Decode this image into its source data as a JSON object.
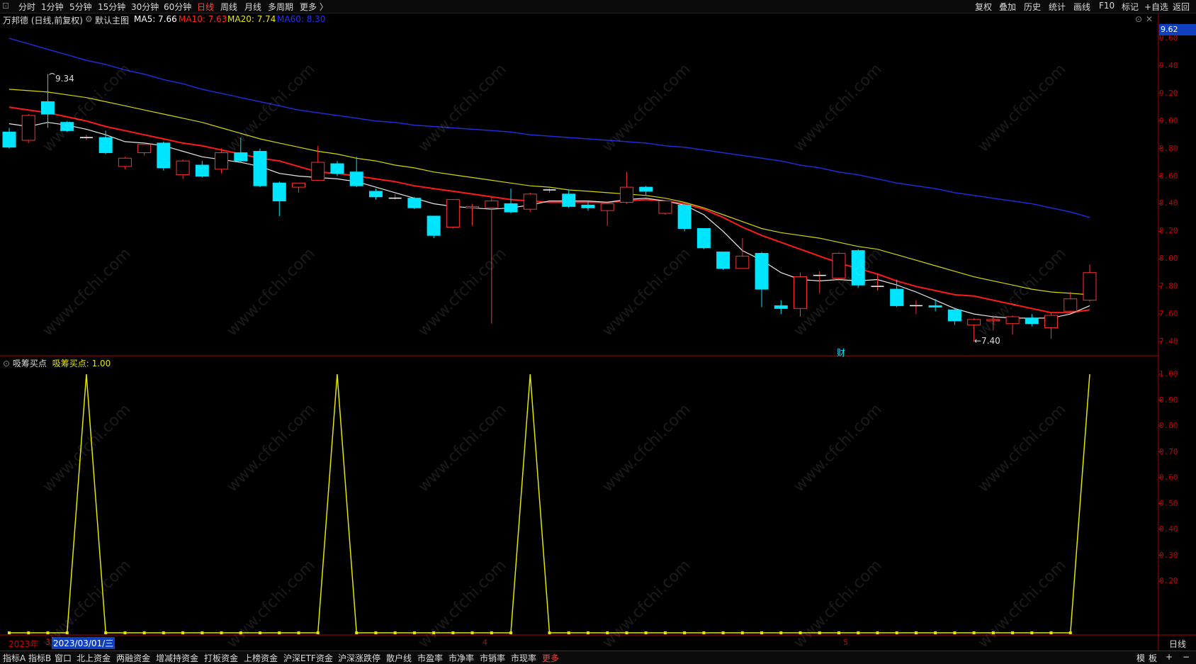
{
  "topbar": {
    "left": [
      "分时",
      "1分钟",
      "5分钟",
      "15分钟",
      "30分钟",
      "60分钟",
      "日线",
      "周线",
      "月线",
      "多周期",
      "更多 〉"
    ],
    "active": "日线",
    "right": [
      "复权",
      "叠加",
      "历史",
      "统计",
      "画线",
      "F10",
      "标记",
      "+自选",
      "返回"
    ]
  },
  "info": {
    "stock": "万邦德 (日线,前复权)",
    "main": "默认主图",
    "ma5": "MA5: 7.66",
    "ma10": "MA10: 7.63",
    "ma20": "MA20: 7.74",
    "ma60": "MA60: 8.30"
  },
  "colors": {
    "ma5": "#ffffff",
    "ma10": "#ff2020",
    "ma20": "#e6e600",
    "ma60": "#2020ff",
    "up": "#ff3030",
    "down": "#00e5ff",
    "axis": "#c80000"
  },
  "price_axis": {
    "current": "9.62",
    "labels": [
      "9.60",
      "9.40",
      "9.20",
      "9.00",
      "8.80",
      "8.60",
      "8.40",
      "8.20",
      "8.00",
      "7.80",
      "7.60",
      "7.40"
    ]
  },
  "annotations": {
    "high": "9.34",
    "low": "←7.40",
    "cai": "财"
  },
  "indicator": {
    "title": "吸筹买点",
    "value": "吸筹买点: 1.00",
    "labels": [
      "1.00",
      "0.90",
      "0.80",
      "0.70",
      "0.60",
      "0.50",
      "0.40",
      "0.30",
      "0.20"
    ]
  },
  "time_axis": {
    "year": "2023年",
    "m3": "3",
    "cursor_date": "2023/03/01/三",
    "m4": "4",
    "m5": "5",
    "right": "日线"
  },
  "bottombar": {
    "left": [
      "指标A",
      "指标B",
      "窗口",
      "北上资金",
      "两融资金",
      "增减持资金",
      "打板资金",
      "上榜资金",
      "沪深ETF资金",
      "沪深涨跌停",
      "散户线",
      "市盈率",
      "市净率",
      "市销率",
      "市现率",
      "更多"
    ],
    "right": [
      "模",
      "板",
      "+",
      "−"
    ]
  },
  "watermark": "www.cfchi.com",
  "chart_data": [
    {
      "type": "candlestick",
      "title": "万邦德 (日线,前复权)",
      "ylim": [
        7.3,
        9.7
      ],
      "candles": [
        {
          "o": 8.92,
          "h": 8.95,
          "l": 8.8,
          "c": 8.81
        },
        {
          "o": 8.86,
          "h": 9.05,
          "l": 8.84,
          "c": 9.04
        },
        {
          "o": 9.14,
          "h": 9.34,
          "l": 8.95,
          "c": 9.05
        },
        {
          "o": 8.99,
          "h": 9.0,
          "l": 8.92,
          "c": 8.93
        },
        {
          "o": 8.88,
          "h": 8.9,
          "l": 8.86,
          "c": 8.88
        },
        {
          "o": 8.88,
          "h": 8.93,
          "l": 8.76,
          "c": 8.77
        },
        {
          "o": 8.67,
          "h": 8.74,
          "l": 8.65,
          "c": 8.73
        },
        {
          "o": 8.77,
          "h": 8.84,
          "l": 8.75,
          "c": 8.83
        },
        {
          "o": 8.84,
          "h": 8.85,
          "l": 8.64,
          "c": 8.66
        },
        {
          "o": 8.61,
          "h": 8.72,
          "l": 8.58,
          "c": 8.71
        },
        {
          "o": 8.68,
          "h": 8.71,
          "l": 8.59,
          "c": 8.6
        },
        {
          "o": 8.65,
          "h": 8.8,
          "l": 8.62,
          "c": 8.77
        },
        {
          "o": 8.77,
          "h": 8.88,
          "l": 8.7,
          "c": 8.71
        },
        {
          "o": 8.78,
          "h": 8.8,
          "l": 8.52,
          "c": 8.53
        },
        {
          "o": 8.55,
          "h": 8.56,
          "l": 8.31,
          "c": 8.42
        },
        {
          "o": 8.52,
          "h": 8.55,
          "l": 8.48,
          "c": 8.55
        },
        {
          "o": 8.57,
          "h": 8.82,
          "l": 8.57,
          "c": 8.7
        },
        {
          "o": 8.69,
          "h": 8.71,
          "l": 8.6,
          "c": 8.62
        },
        {
          "o": 8.63,
          "h": 8.74,
          "l": 8.52,
          "c": 8.53
        },
        {
          "o": 8.49,
          "h": 8.51,
          "l": 8.43,
          "c": 8.45
        },
        {
          "o": 8.44,
          "h": 8.47,
          "l": 8.43,
          "c": 8.44
        },
        {
          "o": 8.44,
          "h": 8.45,
          "l": 8.36,
          "c": 8.37
        },
        {
          "o": 8.31,
          "h": 8.31,
          "l": 8.15,
          "c": 8.17
        },
        {
          "o": 8.23,
          "h": 8.43,
          "l": 8.22,
          "c": 8.43
        },
        {
          "o": 8.37,
          "h": 8.4,
          "l": 8.24,
          "c": 8.38
        },
        {
          "o": 8.37,
          "h": 8.45,
          "l": 7.53,
          "c": 8.42
        },
        {
          "o": 8.4,
          "h": 8.51,
          "l": 8.33,
          "c": 8.34
        },
        {
          "o": 8.36,
          "h": 8.48,
          "l": 8.34,
          "c": 8.47
        },
        {
          "o": 8.5,
          "h": 8.51,
          "l": 8.48,
          "c": 8.5
        },
        {
          "o": 8.47,
          "h": 8.5,
          "l": 8.37,
          "c": 8.38
        },
        {
          "o": 8.39,
          "h": 8.42,
          "l": 8.35,
          "c": 8.37
        },
        {
          "o": 8.35,
          "h": 8.4,
          "l": 8.24,
          "c": 8.4
        },
        {
          "o": 8.41,
          "h": 8.63,
          "l": 8.4,
          "c": 8.52
        },
        {
          "o": 8.52,
          "h": 8.53,
          "l": 8.46,
          "c": 8.49
        },
        {
          "o": 8.33,
          "h": 8.41,
          "l": 8.32,
          "c": 8.42
        },
        {
          "o": 8.39,
          "h": 8.4,
          "l": 8.2,
          "c": 8.22
        },
        {
          "o": 8.22,
          "h": 8.22,
          "l": 8.07,
          "c": 8.08
        },
        {
          "o": 8.05,
          "h": 8.05,
          "l": 7.92,
          "c": 7.93
        },
        {
          "o": 7.93,
          "h": 8.15,
          "l": 7.93,
          "c": 8.02
        },
        {
          "o": 8.04,
          "h": 8.05,
          "l": 7.65,
          "c": 7.78
        },
        {
          "o": 7.66,
          "h": 7.7,
          "l": 7.6,
          "c": 7.64
        },
        {
          "o": 7.64,
          "h": 7.9,
          "l": 7.58,
          "c": 7.87
        },
        {
          "o": 7.88,
          "h": 7.91,
          "l": 7.75,
          "c": 7.88
        },
        {
          "o": 7.86,
          "h": 8.05,
          "l": 7.85,
          "c": 8.04
        },
        {
          "o": 8.06,
          "h": 8.07,
          "l": 7.79,
          "c": 7.81
        },
        {
          "o": 7.8,
          "h": 7.89,
          "l": 7.77,
          "c": 7.8
        },
        {
          "o": 7.78,
          "h": 7.85,
          "l": 7.65,
          "c": 7.66
        },
        {
          "o": 7.66,
          "h": 7.7,
          "l": 7.6,
          "c": 7.66
        },
        {
          "o": 7.66,
          "h": 7.71,
          "l": 7.62,
          "c": 7.65
        },
        {
          "o": 7.63,
          "h": 7.64,
          "l": 7.52,
          "c": 7.55
        },
        {
          "o": 7.52,
          "h": 7.57,
          "l": 7.4,
          "c": 7.56
        },
        {
          "o": 7.55,
          "h": 7.59,
          "l": 7.48,
          "c": 7.56
        },
        {
          "o": 7.53,
          "h": 7.59,
          "l": 7.45,
          "c": 7.58
        },
        {
          "o": 7.57,
          "h": 7.6,
          "l": 7.51,
          "c": 7.53
        },
        {
          "o": 7.5,
          "h": 7.61,
          "l": 7.42,
          "c": 7.59
        },
        {
          "o": 7.62,
          "h": 7.76,
          "l": 7.61,
          "c": 7.71
        },
        {
          "o": 7.7,
          "h": 7.96,
          "l": 7.69,
          "c": 7.9
        }
      ],
      "ma5": [
        8.98,
        8.96,
        8.99,
        8.97,
        8.94,
        8.9,
        8.85,
        8.84,
        8.82,
        8.78,
        8.74,
        8.72,
        8.7,
        8.67,
        8.62,
        8.6,
        8.59,
        8.58,
        8.56,
        8.52,
        8.48,
        8.44,
        8.4,
        8.38,
        8.37,
        8.36,
        8.37,
        8.39,
        8.42,
        8.42,
        8.42,
        8.41,
        8.43,
        8.44,
        8.42,
        8.39,
        8.32,
        8.2,
        8.06,
        7.99,
        7.9,
        7.85,
        7.84,
        7.85,
        7.84,
        7.85,
        7.81,
        7.76,
        7.7,
        7.64,
        7.6,
        7.58,
        7.57,
        7.57,
        7.57,
        7.6,
        7.66
      ],
      "ma10": [
        9.1,
        9.08,
        9.06,
        9.03,
        9.0,
        8.96,
        8.93,
        8.9,
        8.87,
        8.84,
        8.82,
        8.79,
        8.76,
        8.73,
        8.71,
        8.67,
        8.63,
        8.62,
        8.6,
        8.58,
        8.56,
        8.53,
        8.51,
        8.49,
        8.47,
        8.45,
        8.43,
        8.42,
        8.41,
        8.41,
        8.41,
        8.41,
        8.42,
        8.43,
        8.42,
        8.4,
        8.36,
        8.3,
        8.23,
        8.17,
        8.12,
        8.07,
        8.02,
        7.97,
        7.93,
        7.89,
        7.84,
        7.8,
        7.77,
        7.74,
        7.73,
        7.7,
        7.67,
        7.64,
        7.61,
        7.61,
        7.63
      ],
      "ma20": [
        9.23,
        9.22,
        9.21,
        9.19,
        9.17,
        9.14,
        9.11,
        9.08,
        9.05,
        9.02,
        8.99,
        8.95,
        8.91,
        8.87,
        8.84,
        8.81,
        8.78,
        8.76,
        8.73,
        8.71,
        8.68,
        8.66,
        8.63,
        8.61,
        8.59,
        8.57,
        8.55,
        8.53,
        8.52,
        8.5,
        8.49,
        8.48,
        8.47,
        8.46,
        8.44,
        8.41,
        8.37,
        8.32,
        8.27,
        8.22,
        8.19,
        8.17,
        8.15,
        8.12,
        8.09,
        8.07,
        8.03,
        7.99,
        7.95,
        7.91,
        7.87,
        7.84,
        7.81,
        7.78,
        7.76,
        7.75,
        7.74
      ],
      "ma60": [
        9.6,
        9.56,
        9.52,
        9.48,
        9.44,
        9.41,
        9.37,
        9.34,
        9.3,
        9.27,
        9.23,
        9.2,
        9.17,
        9.14,
        9.11,
        9.08,
        9.06,
        9.04,
        9.02,
        9.0,
        8.99,
        8.97,
        8.96,
        8.95,
        8.94,
        8.93,
        8.92,
        8.9,
        8.89,
        8.88,
        8.87,
        8.86,
        8.85,
        8.84,
        8.82,
        8.81,
        8.79,
        8.77,
        8.75,
        8.73,
        8.71,
        8.68,
        8.66,
        8.63,
        8.61,
        8.58,
        8.55,
        8.53,
        8.51,
        8.48,
        8.46,
        8.44,
        8.42,
        8.4,
        8.37,
        8.34,
        8.3
      ]
    },
    {
      "type": "line",
      "title": "吸筹买点",
      "ylim": [
        0,
        1.0
      ],
      "values": [
        0,
        0,
        0,
        0,
        1,
        0,
        0,
        0,
        0,
        0,
        0,
        0,
        0,
        0,
        0,
        0,
        0,
        1,
        0,
        0,
        0,
        0,
        0,
        0,
        0,
        0,
        0,
        1,
        0,
        0,
        0,
        0,
        0,
        0,
        0,
        0,
        0,
        0,
        0,
        0,
        0,
        0,
        0,
        0,
        0,
        0,
        0,
        0,
        0,
        0,
        0,
        0,
        0,
        0,
        0,
        0,
        1
      ]
    }
  ]
}
